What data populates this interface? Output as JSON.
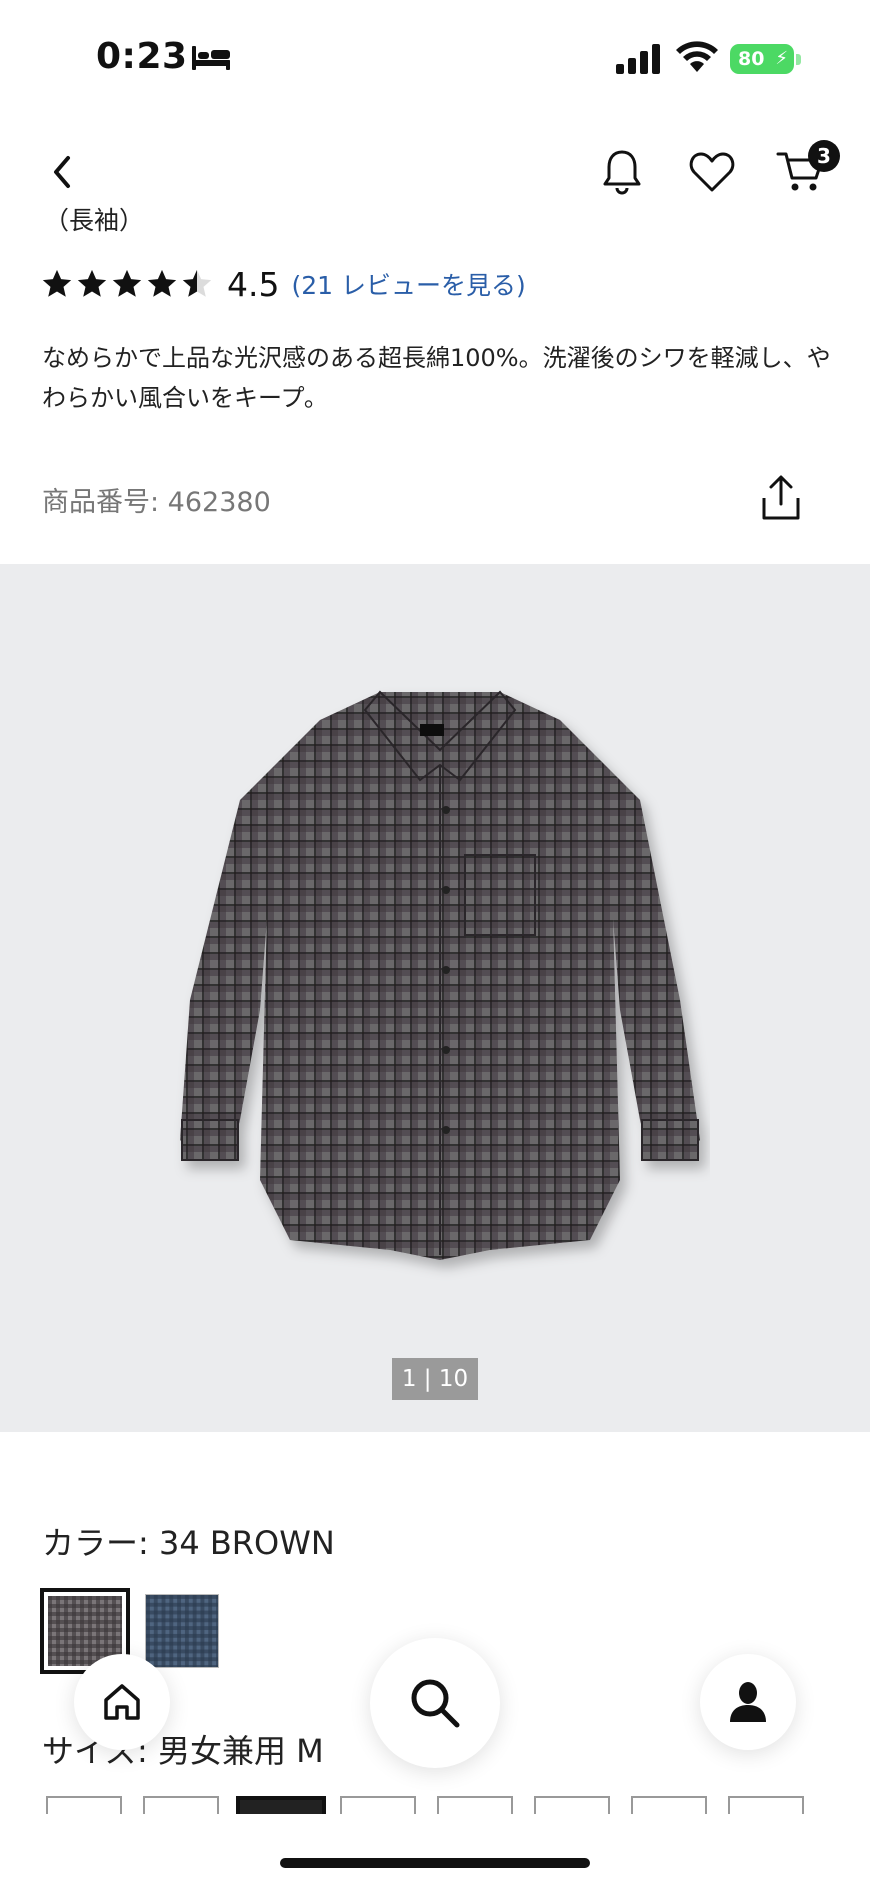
{
  "status_bar": {
    "time": "0:23",
    "battery_percent": "80",
    "icons": [
      "bed-icon",
      "signal-icon",
      "wifi-icon",
      "battery-icon"
    ],
    "battery_color": "#4cd964"
  },
  "nav": {
    "icons": [
      "chevron-left-icon",
      "bell-icon",
      "heart-icon",
      "cart-icon"
    ],
    "cart_count": "3"
  },
  "product": {
    "partial_title": "（長袖）",
    "rating_value": "4.5",
    "rating_stars": 4.5,
    "reviews_link": "(21 レビューを見る)",
    "description": "なめらかで上品な光沢感のある超長綿100%。洗濯後のシワを軽減し、やわらかい風合いをキープ。",
    "product_number": "商品番号: 462380"
  },
  "gallery": {
    "pager": "1 | 10",
    "current_image": 1,
    "total_images": 10
  },
  "color": {
    "label": "カラー: 34 BROWN",
    "swatches": [
      {
        "name": "34 BROWN",
        "selected": true,
        "color": "#5a5458"
      },
      {
        "name": "navy check",
        "selected": false,
        "color": "#3e4f66"
      }
    ]
  },
  "size": {
    "label": "サイズ: 男女兼用 M",
    "selected_index": 2,
    "visible_count": 8
  },
  "bottom_nav": {
    "icons": [
      "home-icon",
      "search-icon",
      "account-icon"
    ]
  },
  "colors": {
    "link": "#2a5ea8",
    "image_background": "#ebecee",
    "pager_background": "#9a9a9a"
  }
}
